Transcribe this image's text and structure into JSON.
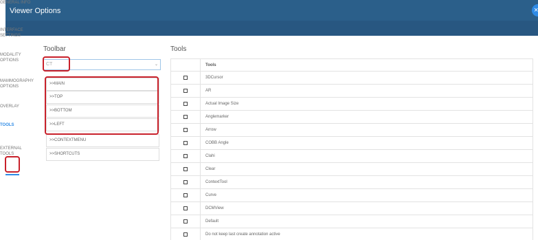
{
  "window": {
    "title": "Viewer Options",
    "close_icon": "×"
  },
  "sidebar": {
    "items": [
      {
        "label": "GENERAL INFO"
      },
      {
        "label": "INTERFACE SETTINGS"
      },
      {
        "label": "MODALITY OPTIONS"
      },
      {
        "label": "MAMMOGRAPHY OPTIONS"
      },
      {
        "label": "OVERLAY"
      },
      {
        "label": "TOOLS",
        "active": true
      },
      {
        "label": "EXTERNAL TOOLS"
      }
    ]
  },
  "toolbar": {
    "heading": "Toolbar",
    "selected": "CT",
    "caret": "⌄",
    "items": [
      {
        "label": ">>MAIN"
      },
      {
        "label": ">>TOP"
      },
      {
        "label": ">>BOTTOM"
      },
      {
        "label": ">>LEFT"
      },
      {
        "label": ">>CONTEXTMENU"
      },
      {
        "label": ">>SHORTCUTS"
      }
    ]
  },
  "tools": {
    "heading": "Tools",
    "column_header": "Tools",
    "rows": [
      "3DCursor",
      "AR",
      "Actual Image Size",
      "Anglemarker",
      "Arrow",
      "COBB Angle",
      "Clahi",
      "Clear",
      "ContextTool",
      "Curve",
      "DCMView",
      "Default",
      "Do not keep last create annotation active"
    ]
  },
  "colors": {
    "header": "#2b5f8a",
    "accent": "#2f8be6",
    "highlight": "#c8202a"
  }
}
